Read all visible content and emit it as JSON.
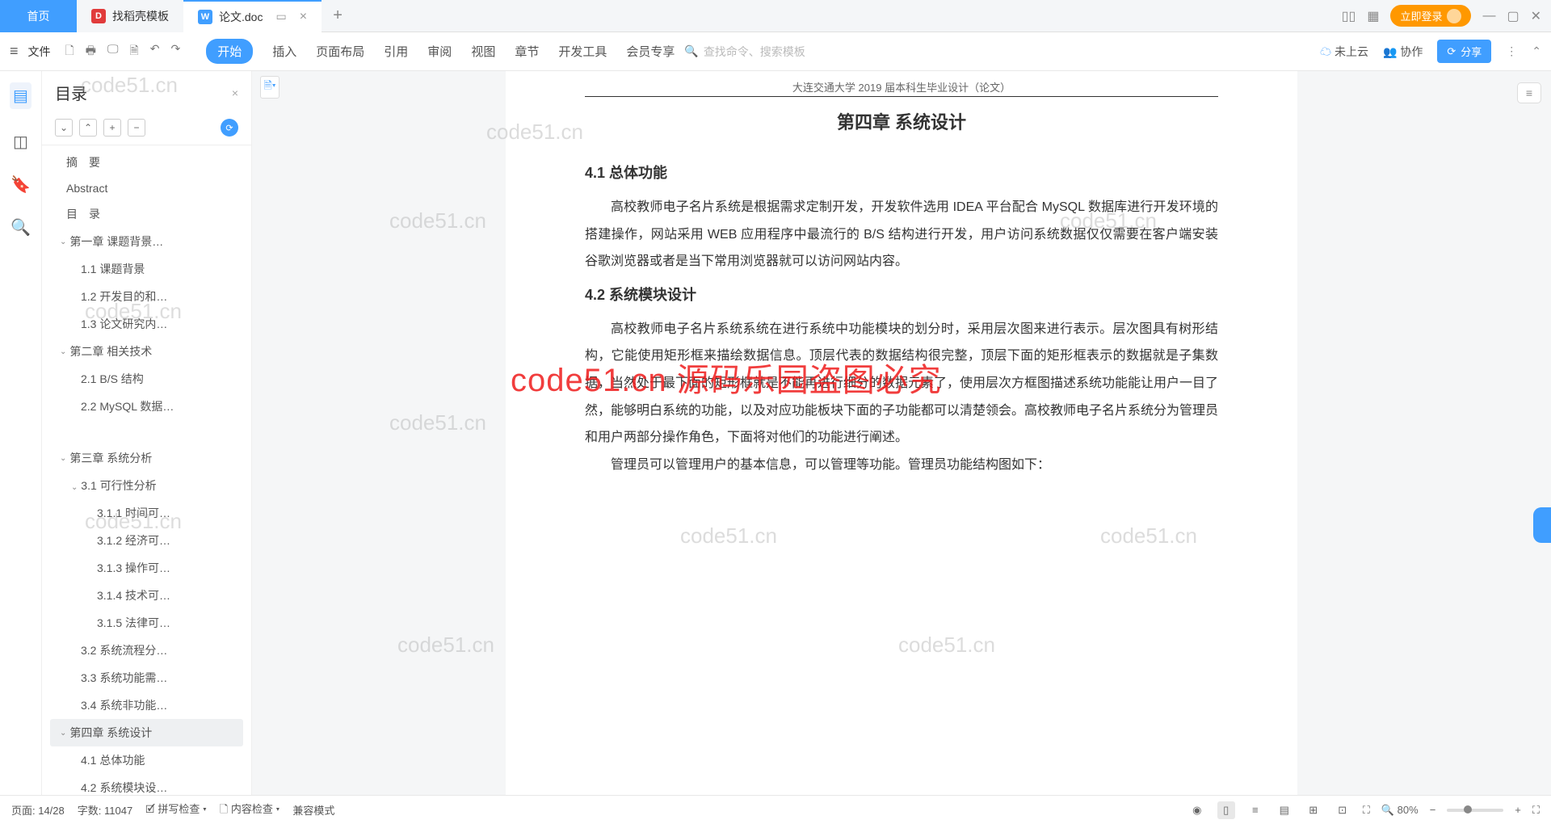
{
  "titlebar": {
    "home": "首页",
    "tab1": "找稻壳模板",
    "tab2": "论文.doc",
    "login": "立即登录"
  },
  "ribbon": {
    "file": "文件",
    "menu": [
      "开始",
      "插入",
      "页面布局",
      "引用",
      "审阅",
      "视图",
      "章节",
      "开发工具",
      "会员专享"
    ],
    "search_ph": "查找命令、搜索模板",
    "cloud": "未上云",
    "collab": "协作",
    "share": "分享"
  },
  "sidebar": {
    "title": "目录",
    "items": [
      {
        "t": "摘　要",
        "lvl": 0
      },
      {
        "t": "Abstract",
        "lvl": 0
      },
      {
        "t": "目　录",
        "lvl": 0
      },
      {
        "t": "第一章  课题背景…",
        "lvl": 1,
        "caret": true
      },
      {
        "t": "1.1 课题背景",
        "lvl": 2
      },
      {
        "t": "1.2 开发目的和…",
        "lvl": 2
      },
      {
        "t": "1.3 论文研究内…",
        "lvl": 2
      },
      {
        "t": "第二章  相关技术",
        "lvl": 1,
        "caret": true
      },
      {
        "t": "2.1 B/S 结构",
        "lvl": 2
      },
      {
        "t": "2.2 MySQL 数据…",
        "lvl": 2
      },
      {
        "t": "",
        "lvl": 2,
        "blank": true
      },
      {
        "t": "第三章  系统分析",
        "lvl": 1,
        "caret": true
      },
      {
        "t": "3.1 可行性分析",
        "lvl": 2,
        "caret": true,
        "sub": true
      },
      {
        "t": "3.1.1 时间可…",
        "lvl": 3
      },
      {
        "t": "3.1.2 经济可…",
        "lvl": 3
      },
      {
        "t": "3.1.3 操作可…",
        "lvl": 3
      },
      {
        "t": "3.1.4 技术可…",
        "lvl": 3
      },
      {
        "t": "3.1.5 法律可…",
        "lvl": 3
      },
      {
        "t": "3.2 系统流程分…",
        "lvl": 2
      },
      {
        "t": "3.3 系统功能需…",
        "lvl": 2
      },
      {
        "t": "3.4 系统非功能…",
        "lvl": 2
      },
      {
        "t": "第四章  系统设计",
        "lvl": 1,
        "caret": true,
        "active": true
      },
      {
        "t": "4.1 总体功能",
        "lvl": 2
      },
      {
        "t": "4.2 系统模块设…",
        "lvl": 2
      }
    ]
  },
  "doc": {
    "header": "大连交通大学 2019 届本科生毕业设计（论文）",
    "chapter": "第四章  系统设计",
    "s41": "4.1  总体功能",
    "p1": "高校教师电子名片系统是根据需求定制开发，开发软件选用 IDEA 平台配合 MySQL 数据库进行开发环境的搭建操作，网站采用 WEB 应用程序中最流行的 B/S 结构进行开发，用户访问系统数据仅仅需要在客户端安装谷歌浏览器或者是当下常用浏览器就可以访问网站内容。",
    "s42": "4.2  系统模块设计",
    "p2": "高校教师电子名片系统系统在进行系统中功能模块的划分时，采用层次图来进行表示。层次图具有树形结构，它能使用矩形框来描绘数据信息。顶层代表的数据结构很完整，顶层下面的矩形框表示的数据就是子集数据，当然处于最下面的矩形框就是不能再进行细分的数据元素了，使用层次方框图描述系统功能能让用户一目了然，能够明白系统的功能，以及对应功能板块下面的子功能都可以清楚领会。高校教师电子名片系统分为管理员和用户两部分操作角色，下面将对他们的功能进行阐述。",
    "p3": "管理员可以管理用户的基本信息，可以管理等功能。管理员功能结构图如下："
  },
  "status": {
    "page": "页面: 14/28",
    "words": "字数: 11047",
    "spell": "拼写检查",
    "content": "内容检查",
    "compat": "兼容模式",
    "zoom": "80%"
  },
  "watermark": "code51.cn",
  "redtext": "code51.cn 源码乐园盗图必究"
}
